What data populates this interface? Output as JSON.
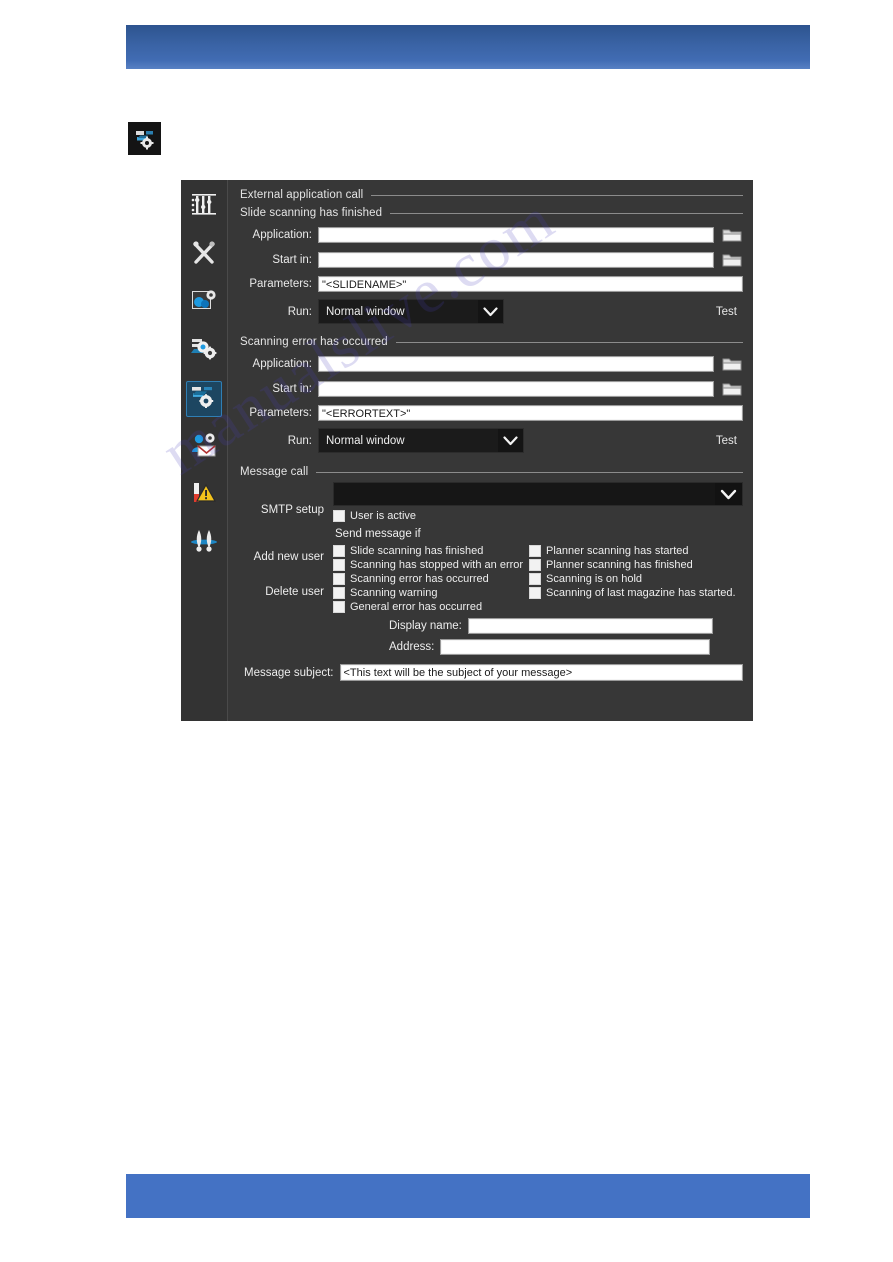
{
  "page": {
    "watermark": "manualslive.com"
  },
  "doc_icon": {
    "name": "external-application-settings-icon"
  },
  "dialog": {
    "sidebar": {
      "items": [
        {
          "name": "sliders-settings-icon",
          "label": "Controls",
          "selected": false
        },
        {
          "name": "tools-wrench-screwdriver-icon",
          "label": "Maintenance",
          "selected": false
        },
        {
          "name": "image-settings-icon",
          "label": "Image settings",
          "selected": false
        },
        {
          "name": "preview-gear-icon",
          "label": "Preview settings",
          "selected": false
        },
        {
          "name": "external-application-gear-icon",
          "label": "External application call",
          "selected": true
        },
        {
          "name": "user-message-icon",
          "label": "User messages",
          "selected": false
        },
        {
          "name": "warning-alert-icon",
          "label": "Alerts",
          "selected": false
        },
        {
          "name": "calibration-icon",
          "label": "Calibration",
          "selected": false
        }
      ]
    },
    "external_application_call": {
      "title": "External application call",
      "groups": [
        {
          "title": "Slide scanning has finished",
          "application_label": "Application:",
          "application_value": "",
          "start_in_label": "Start in:",
          "start_in_value": "",
          "parameters_label": "Parameters:",
          "parameters_value": "\"<SLIDENAME>\"",
          "run_label": "Run:",
          "run_value": "Normal window",
          "test_label": "Test"
        },
        {
          "title": "Scanning error has occurred",
          "application_label": "Application:",
          "application_value": "",
          "start_in_label": "Start in:",
          "start_in_value": "",
          "parameters_label": "Parameters:",
          "parameters_value": "\"<ERRORTEXT>\"",
          "run_label": "Run:",
          "run_value": "Normal window",
          "test_label": "Test"
        }
      ]
    },
    "message_call": {
      "title": "Message call",
      "actions": [
        {
          "label": "SMTP setup"
        },
        {
          "label": "Add new user"
        },
        {
          "label": "Delete user"
        }
      ],
      "smtp_value": "",
      "user_is_active": {
        "label": "User is active",
        "checked": false
      },
      "send_message_if_label": "Send message if",
      "checkboxes_left": [
        {
          "label": "Slide scanning has finished",
          "checked": false
        },
        {
          "label": "Scanning has stopped with an error",
          "checked": false
        },
        {
          "label": "Scanning error has occurred",
          "checked": false
        },
        {
          "label": "Scanning warning",
          "checked": false
        },
        {
          "label": "General error has occurred",
          "checked": false
        }
      ],
      "checkboxes_right": [
        {
          "label": "Planner scanning has started",
          "checked": false
        },
        {
          "label": "Planner scanning has finished",
          "checked": false
        },
        {
          "label": "Scanning is on hold",
          "checked": false
        },
        {
          "label": "Scanning of last magazine has started.",
          "checked": false
        }
      ],
      "display_name_label": "Display name:",
      "display_name_value": "",
      "address_label": "Address:",
      "address_value": "",
      "message_subject_label": "Message subject:",
      "message_subject_value": "<This text will be the subject of your message>"
    }
  },
  "colors": {
    "bar_blue": "#4472c4",
    "dialog_bg": "#373737",
    "sidebar_bg": "#333333",
    "selected_blue": "#1d4661",
    "selected_border": "#2f7fb5"
  }
}
